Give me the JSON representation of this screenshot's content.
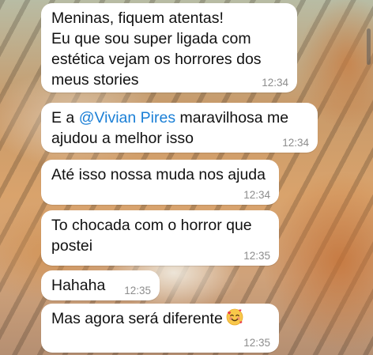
{
  "messages": [
    {
      "text": "Meninas, fiquem atentas!\nEu que sou super ligada com\nestética vejam os horrores dos\nmeus stories",
      "time": "12:34"
    },
    {
      "prefix": "E a ",
      "mention": "@Vivian Pires",
      "suffix": " maravilhosa me\najudou a melhor isso",
      "time": "12:34"
    },
    {
      "text": "Até isso nossa muda nos ajuda",
      "time": "12:34"
    },
    {
      "text": "To chocada com o horror que\npostei",
      "time": "12:35"
    },
    {
      "text": "Hahaha",
      "time": "12:35"
    },
    {
      "text": "Mas agora será diferente",
      "emoji": "smiling-face-with-hearts-icon",
      "time": "12:35"
    }
  ],
  "colors": {
    "bubble": "#ffffff",
    "mention": "#1a7fd6",
    "timestamp": "#8d8d8d"
  }
}
